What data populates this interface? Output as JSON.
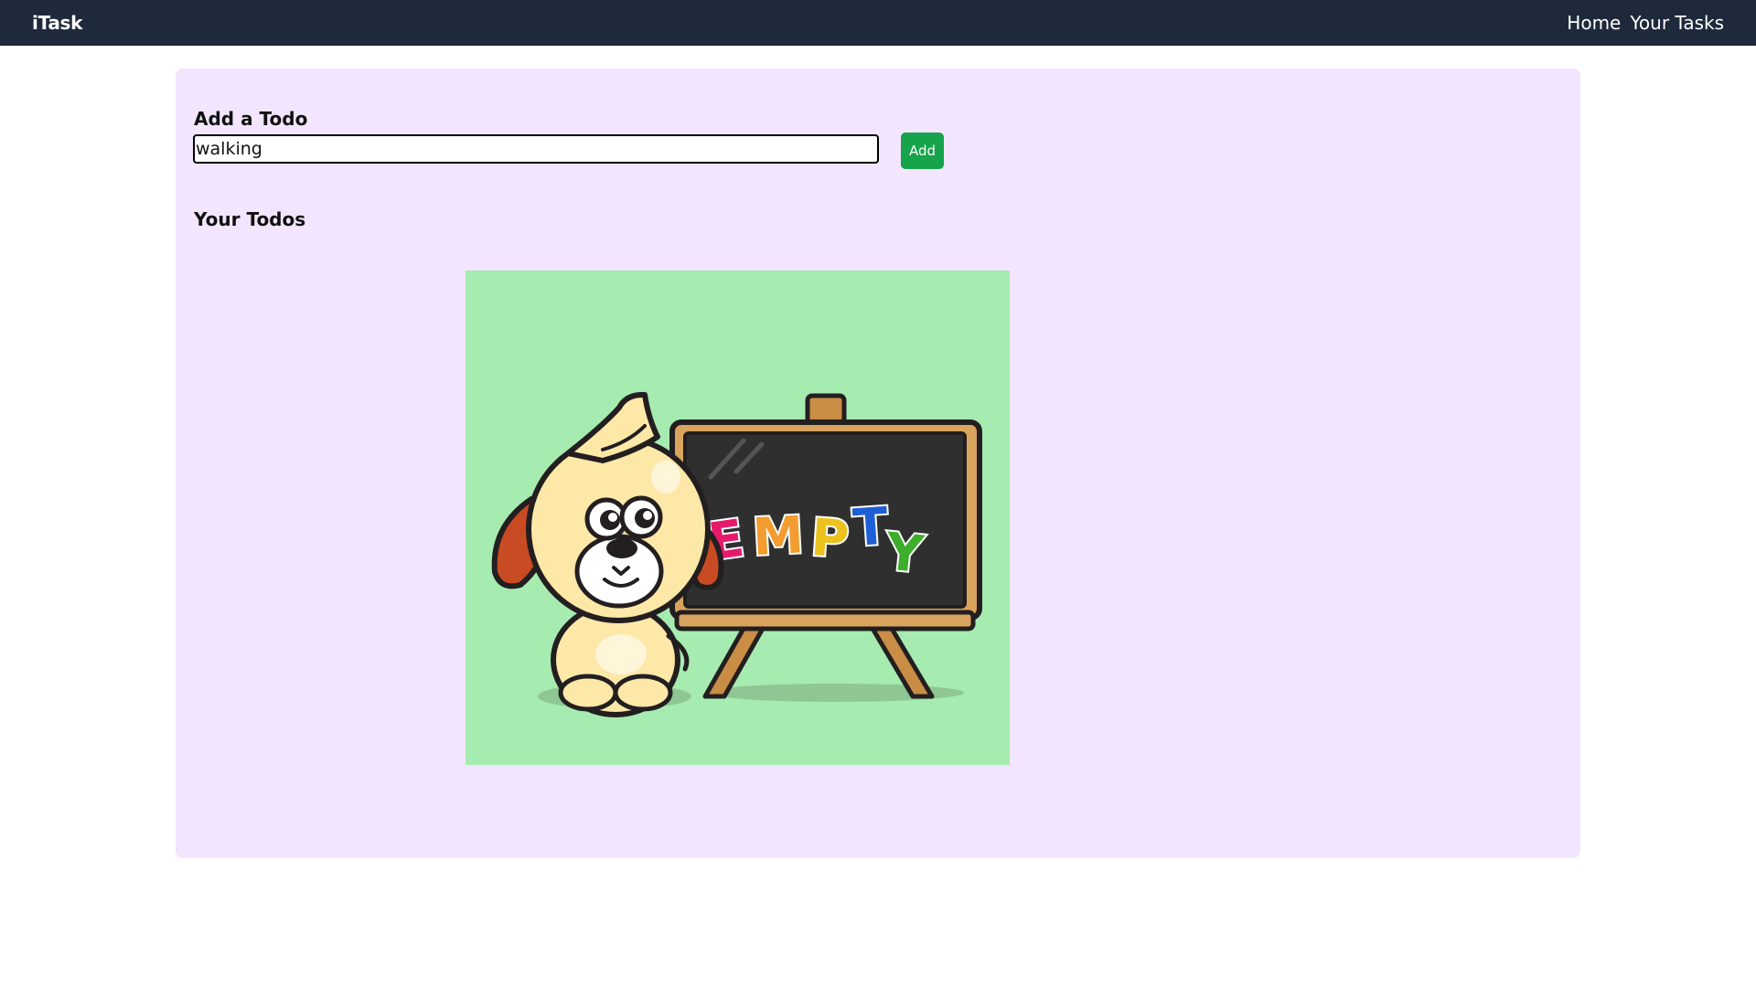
{
  "navbar": {
    "brand": "iTask",
    "links": [
      "Home",
      "Your Tasks"
    ],
    "background_color": "#1e293b"
  },
  "add_todo": {
    "title": "Add a Todo",
    "input_value": "walking",
    "button_label": "Add",
    "button_color": "#16a34a"
  },
  "todos": {
    "title": "Your Todos",
    "empty_illustration": {
      "icon": "puppy-chalkboard-illustration",
      "board_text": "EMPTY",
      "background_color": "#a6ebb0"
    }
  },
  "card_color": "#f3e5fe"
}
